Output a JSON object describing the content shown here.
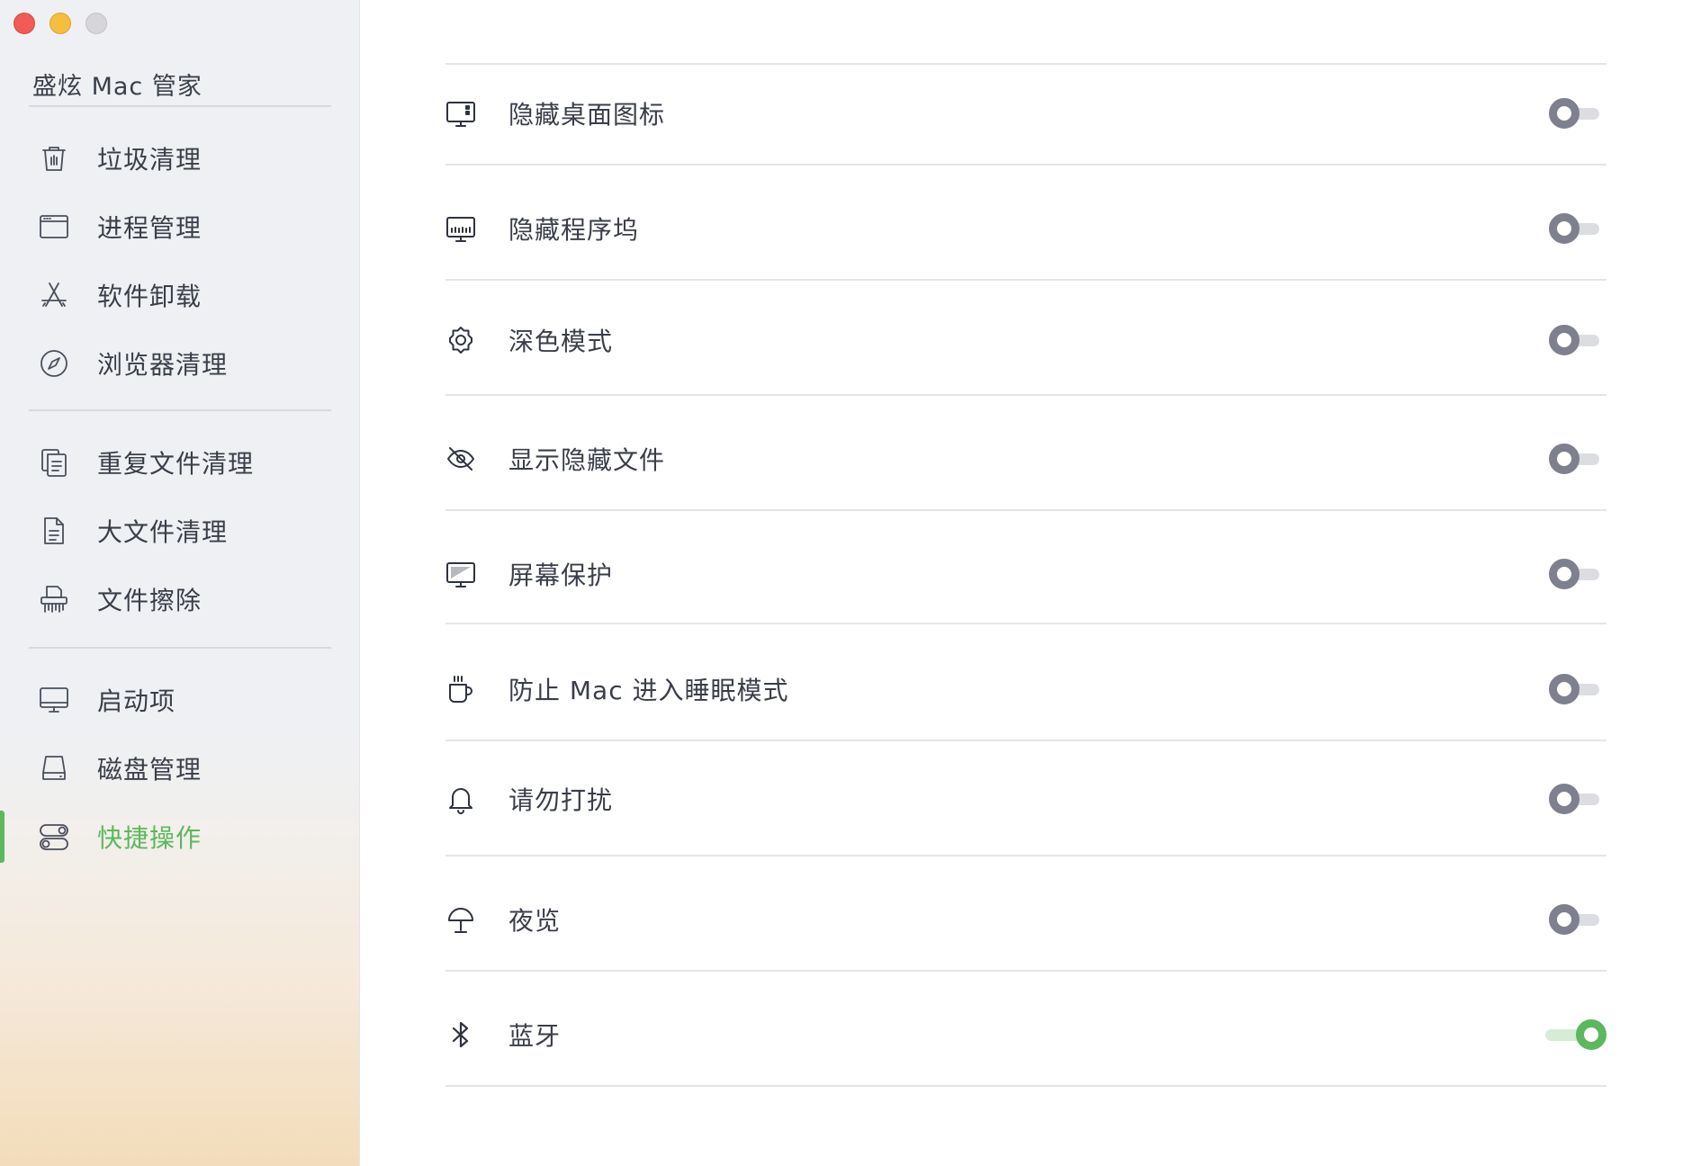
{
  "app": {
    "title": "盛炫 Mac 管家"
  },
  "theme": {
    "accent": "#5cb85c",
    "toggle_off": "#7e818d"
  },
  "sidebar": {
    "items": [
      {
        "label": "垃圾清理",
        "icon": "trash-icon",
        "active": false
      },
      {
        "label": "进程管理",
        "icon": "window-icon",
        "active": false
      },
      {
        "label": "软件卸载",
        "icon": "app-store-icon",
        "active": false
      },
      {
        "label": "浏览器清理",
        "icon": "compass-icon",
        "active": false
      },
      {
        "label": "重复文件清理",
        "icon": "duplicate-files-icon",
        "active": false
      },
      {
        "label": "大文件清理",
        "icon": "document-icon",
        "active": false
      },
      {
        "label": "文件擦除",
        "icon": "shredder-icon",
        "active": false
      },
      {
        "label": "启动项",
        "icon": "monitor-icon",
        "active": false
      },
      {
        "label": "磁盘管理",
        "icon": "disk-icon",
        "active": false
      },
      {
        "label": "快捷操作",
        "icon": "toggles-icon",
        "active": true
      }
    ]
  },
  "settings": {
    "rows": [
      {
        "label": "隐藏桌面图标",
        "icon": "desktop-icons-icon",
        "enabled": false
      },
      {
        "label": "隐藏程序坞",
        "icon": "dock-icon",
        "enabled": false
      },
      {
        "label": "深色模式",
        "icon": "gear-icon",
        "enabled": false
      },
      {
        "label": "显示隐藏文件",
        "icon": "eye-slash-icon",
        "enabled": false
      },
      {
        "label": "屏幕保护",
        "icon": "screensaver-icon",
        "enabled": false
      },
      {
        "label": "防止 Mac 进入睡眠模式",
        "icon": "coffee-cup-icon",
        "enabled": false
      },
      {
        "label": "请勿打扰",
        "icon": "bell-icon",
        "enabled": false
      },
      {
        "label": "夜览",
        "icon": "lamp-icon",
        "enabled": false
      },
      {
        "label": "蓝牙",
        "icon": "bluetooth-icon",
        "enabled": true
      }
    ]
  }
}
